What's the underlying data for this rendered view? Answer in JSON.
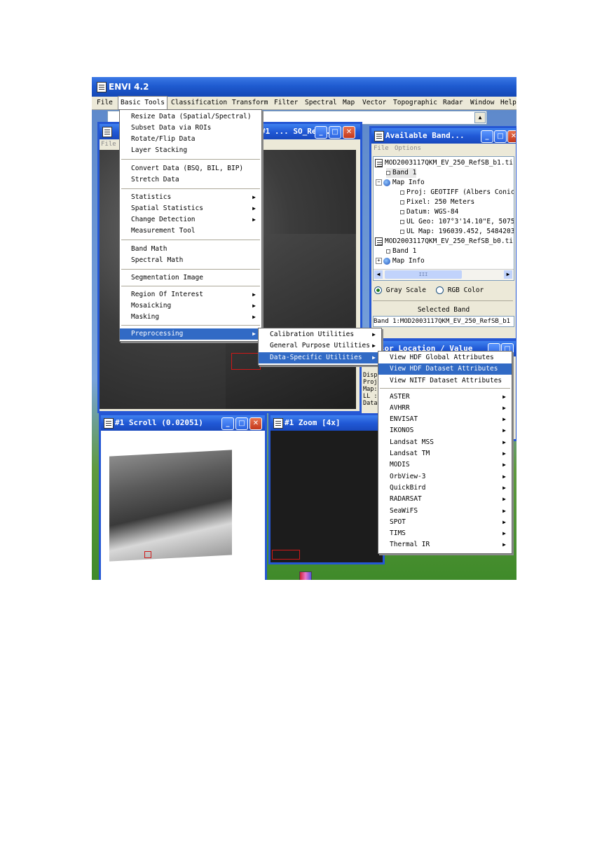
{
  "app": {
    "title": "ENVI 4.2"
  },
  "menubar": [
    "File",
    "Basic Tools",
    "Classification",
    "Transform",
    "Filter",
    "Spectral",
    "Map",
    "Vector",
    "Topographic",
    "Radar",
    "Window",
    "Help"
  ],
  "image_window": {
    "title": "#1 ... SO_RefS...",
    "menu_partial": "File"
  },
  "basic_tools_menu": {
    "items": [
      {
        "label": "Resize Data (Spatial/Spectral)",
        "arrow": false
      },
      {
        "label": "Subset Data via ROIs",
        "arrow": false
      },
      {
        "label": "Rotate/Flip Data",
        "arrow": false
      },
      {
        "label": "Layer Stacking",
        "arrow": false
      },
      {
        "label": "Convert Data (BSQ, BIL, BIP)",
        "arrow": false
      },
      {
        "label": "Stretch Data",
        "arrow": false
      },
      {
        "label": "Statistics",
        "arrow": true
      },
      {
        "label": "Spatial Statistics",
        "arrow": true
      },
      {
        "label": "Change Detection",
        "arrow": true
      },
      {
        "label": "Measurement Tool",
        "arrow": false
      },
      {
        "label": "Band Math",
        "arrow": false
      },
      {
        "label": "Spectral Math",
        "arrow": false
      },
      {
        "label": "Segmentation Image",
        "arrow": false
      },
      {
        "label": "Region Of Interest",
        "arrow": true
      },
      {
        "label": "Mosaicking",
        "arrow": true
      },
      {
        "label": "Masking",
        "arrow": true
      },
      {
        "label": "Preprocessing",
        "arrow": true
      }
    ]
  },
  "preprocessing_menu": {
    "items": [
      {
        "label": "Calibration Utilities"
      },
      {
        "label": "General Purpose Utilities"
      },
      {
        "label": "Data-Specific Utilities"
      }
    ]
  },
  "data_specific_menu": {
    "items": [
      "View HDF Global Attributes",
      "View HDF Dataset Attributes",
      "View NITF Dataset Attributes",
      "ASTER",
      "AVHRR",
      "ENVISAT",
      "IKONOS",
      "Landsat MSS",
      "Landsat TM",
      "MODIS",
      "OrbView-3",
      "QuickBird",
      "RADARSAT",
      "SeaWiFS",
      "SPOT",
      "TIMS",
      "Thermal IR"
    ]
  },
  "available_bands": {
    "title": "Available Band...",
    "menu": [
      "File",
      "Options"
    ],
    "tree": [
      "MOD2003117QKM_EV_250_RefSB_b1.tif",
      "Band 1",
      "Map Info",
      "Proj: GEOTIFF (Albers Conic",
      "Pixel: 250 Meters",
      "Datum: WGS-84",
      "UL Geo: 107°3'14.10\"E, 5075",
      "UL Map: 196039.452, 5484203",
      "MOD2003117QKM_EV_250_RefSB_b0.tif",
      "Band 1",
      "Map Info"
    ],
    "scroll_mark": "III",
    "gray_scale": "Gray Scale",
    "rgb_color": "RGB Color",
    "selected_band_label": "Selected Band",
    "selected_band_value": "Band 1:MOD2003117QKM_EV_250_RefSB_b1"
  },
  "cursor_window": {
    "title": "Cursor Location / Value",
    "lines": [
      "Disp",
      "Proj",
      "Map:",
      "LL :",
      "Data"
    ]
  },
  "scroll_window": {
    "title": "#1 Scroll (0.02051)"
  },
  "zoom_window": {
    "title": "#1 Zoom [4x]"
  }
}
